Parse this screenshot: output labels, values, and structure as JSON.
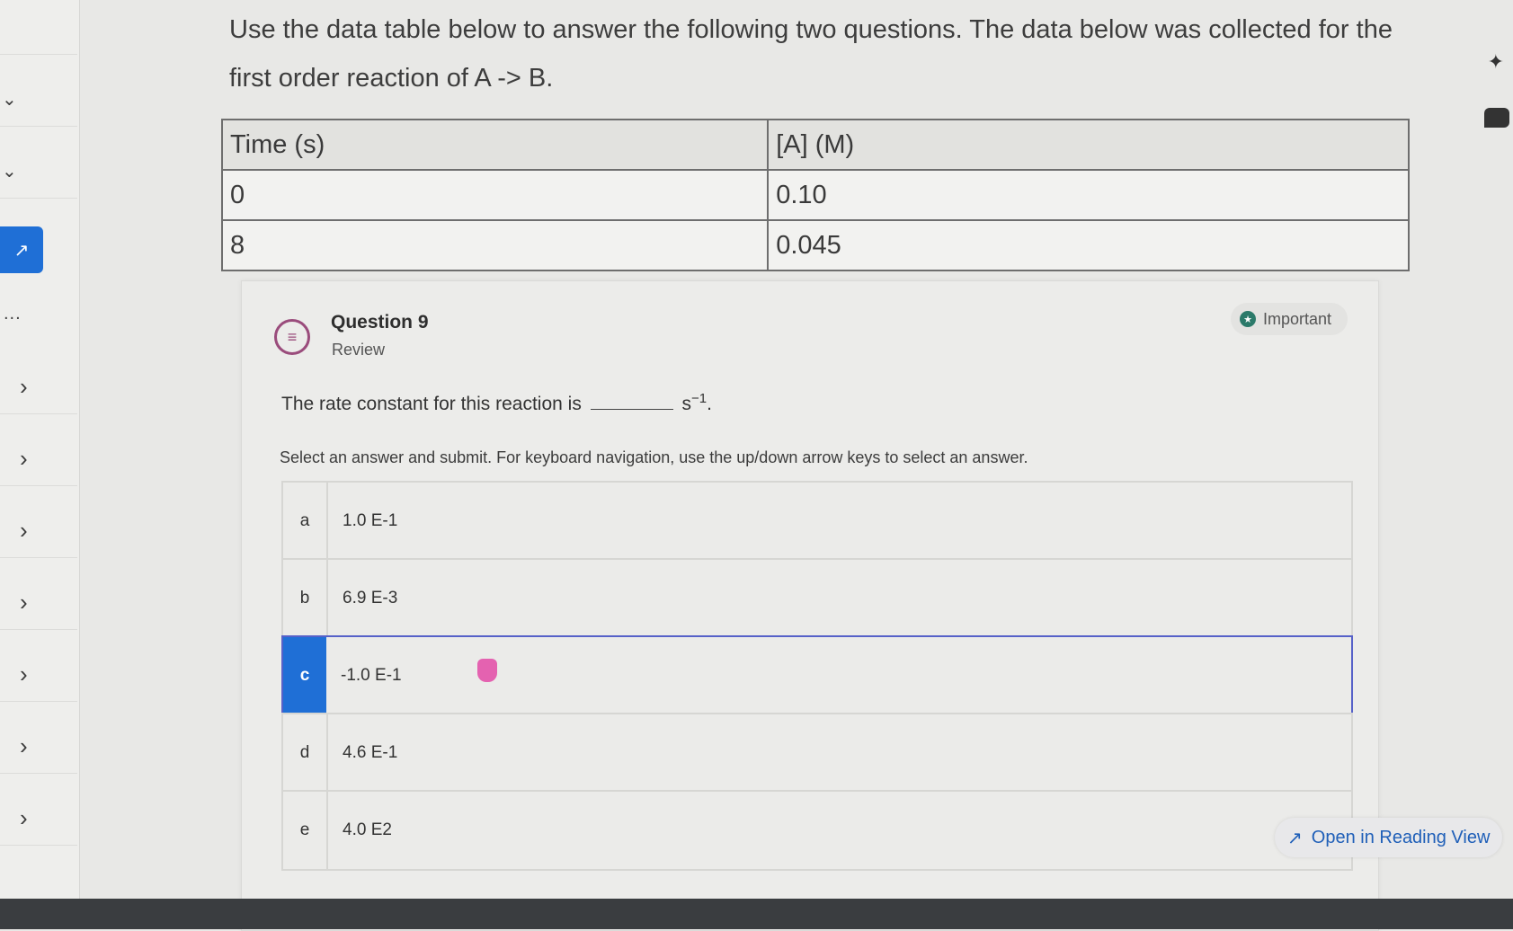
{
  "intro": {
    "line1": "Use the data table below to answer the following two questions. The data below was collected for the",
    "line2": "first order reaction of A -> B."
  },
  "table": {
    "headers": [
      "Time (s)",
      "[A] (M)"
    ],
    "rows": [
      [
        "0",
        "0.10"
      ],
      [
        "8",
        "0.045"
      ]
    ]
  },
  "question": {
    "title": "Question 9",
    "subtitle": "Review",
    "important_label": "Important",
    "stem_before": "The rate constant for this reaction is",
    "stem_unit_base": "s",
    "stem_unit_exp": "−1",
    "stem_end": ".",
    "instructions": "Select an answer and submit. For keyboard navigation, use the up/down arrow keys to select an answer.",
    "choices": [
      {
        "letter": "a",
        "text": "1.0 E-1"
      },
      {
        "letter": "b",
        "text": "6.9 E-3"
      },
      {
        "letter": "c",
        "text": "-1.0 E-1",
        "selected": true
      },
      {
        "letter": "d",
        "text": "4.6 E-1"
      },
      {
        "letter": "e",
        "text": "4.0 E2"
      }
    ]
  },
  "reading_view": {
    "label": "Open in Reading View",
    "icon": "expand-arrows-icon"
  },
  "rail": {
    "expand_icon": "expand-arrows-icon",
    "more_label": "..."
  },
  "colors": {
    "accent": "#1f6fd6",
    "selected_border": "#5661c8",
    "question_icon": "#9a4c7c",
    "important_icon": "#2b7a6a"
  }
}
